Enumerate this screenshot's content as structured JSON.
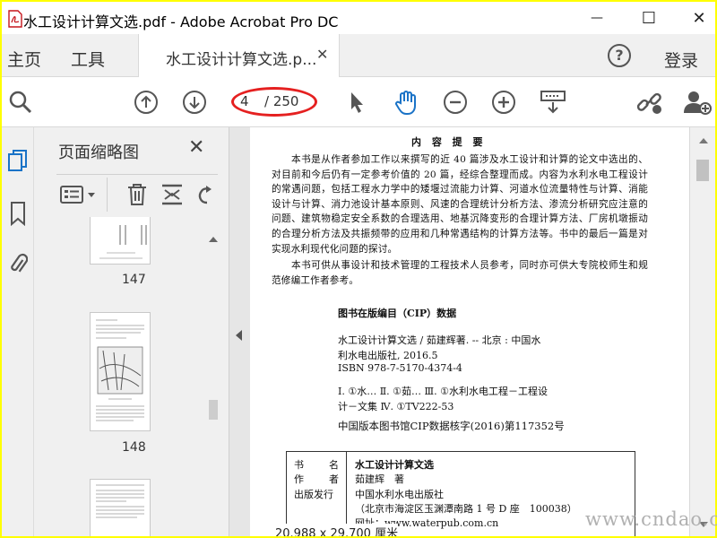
{
  "window": {
    "title": "水工设计计算文选.pdf - Adobe Acrobat Pro DC",
    "minimize_glyph": "—",
    "maximize_glyph": "☐",
    "close_glyph": "✕"
  },
  "menubar": {
    "home": "主页",
    "tools": "工具",
    "doc_tab_label": "水工设计计算文选.p...",
    "doc_tab_close": "✕",
    "help": "?",
    "login": "登录"
  },
  "toolbar": {
    "current_page": "4",
    "total_pages": "/ 250",
    "icons": [
      "search-icon",
      "page-up-icon",
      "page-down-icon",
      "select-arrow-icon",
      "hand-tool-icon",
      "zoom-out-icon",
      "zoom-in-icon",
      "page-display-icon",
      "share-link-icon",
      "add-user-icon"
    ],
    "accent_color": "#1a73c7",
    "highlight_color": "#e52020"
  },
  "rail": {
    "icons": [
      "page-thumbnails-icon",
      "bookmark-icon",
      "attachment-icon"
    ]
  },
  "thumb_panel": {
    "title": "页面缩略图",
    "close": "✕",
    "thumbnails": [
      {
        "label": "147"
      },
      {
        "label": "148"
      }
    ]
  },
  "document": {
    "heading": "内 容 提 要",
    "paragraph1": "本书是从作者参加工作以来撰写的近 40 篇涉及水工设计和计算的论文中选出的、对目前和今后仍有一定参考价值的 20 篇，经综合整理而成。内容为水利水电工程设计的常遇问题，包括工程水力学中的矮堰过流能力计算、河道水位流量特性与计算、消能设计与计算、消力池设计基本原则、风速的合理统计分析方法、渗流分析研究应注意的问题、建筑物稳定安全系数的合理选用、地基沉降变形的合理计算方法、厂房机墩振动的合理分析方法及共振频带的应用和几种常遇结构的计算方法等。书中的最后一篇是对实现水利现代化问题的探讨。",
    "paragraph2": "本书可供从事设计和技术管理的工程技术人员参考，同时亦可供大专院校师生和规范修编工作者参考。",
    "cip_heading": "图书在版编目（CIP）数据",
    "cip_line1": "水工设计计算文选 / 茹建辉著. -- 北京 : 中国水",
    "cip_line2": "利水电出版社, 2016.5",
    "cip_line3": "ISBN 978-7-5170-4374-4",
    "cip_line4": "Ⅰ. ①水… Ⅱ. ①茹… Ⅲ. ①水利水电工程－工程设",
    "cip_line5": "计－文集 Ⅳ. ①TV222-53",
    "cip_number": "中国版本图书馆CIP数据核字(2016)第117352号",
    "box_rows": [
      {
        "label": "书　　名",
        "value": "水工设计计算文选"
      },
      {
        "label": "作　　者",
        "value": "茹建辉　著"
      },
      {
        "label": "出版发行",
        "value": "中国水利水电出版社"
      },
      {
        "label": "",
        "value": "（北京市海淀区玉渊潭南路 1 号 D 座　100038）"
      },
      {
        "label": "",
        "value": "网址：www.waterpub.com.cn"
      }
    ]
  },
  "status": {
    "page_size": "20.988 x 29.700 厘米"
  },
  "watermark": "www.cndao.com"
}
